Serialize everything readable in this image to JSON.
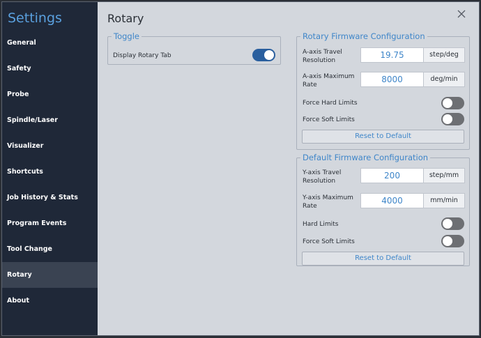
{
  "sidebar": {
    "title": "Settings",
    "items": [
      {
        "label": "General"
      },
      {
        "label": "Safety"
      },
      {
        "label": "Probe"
      },
      {
        "label": "Spindle/Laser"
      },
      {
        "label": "Visualizer"
      },
      {
        "label": "Shortcuts"
      },
      {
        "label": "Job History & Stats"
      },
      {
        "label": "Program Events"
      },
      {
        "label": "Tool Change"
      },
      {
        "label": "Rotary"
      },
      {
        "label": "About"
      }
    ],
    "active": "Rotary"
  },
  "main": {
    "title": "Rotary",
    "toggle_group": {
      "legend": "Toggle",
      "display_rotary_tab": {
        "label": "Display Rotary Tab",
        "on": true
      }
    },
    "rotary_firmware": {
      "legend": "Rotary Firmware Configuration",
      "travel_resolution": {
        "label_line1": "A-axis Travel",
        "label_line2": "Resolution",
        "value": "19.75",
        "unit": "step/deg"
      },
      "max_rate": {
        "label_line1": "A-axis Maximum",
        "label_line2": "Rate",
        "value": "8000",
        "unit": "deg/min"
      },
      "force_hard_limits": {
        "label": "Force Hard Limits",
        "on": false
      },
      "force_soft_limits": {
        "label": "Force Soft Limits",
        "on": false
      },
      "reset_label": "Reset to Default"
    },
    "default_firmware": {
      "legend": "Default Firmware Configuration",
      "travel_resolution": {
        "label_line1": "Y-axis Travel",
        "label_line2": "Resolution",
        "value": "200",
        "unit": "step/mm"
      },
      "max_rate": {
        "label_line1": "Y-axis Maximum",
        "label_line2": "Rate",
        "value": "4000",
        "unit": "mm/min"
      },
      "hard_limits": {
        "label": "Hard Limits",
        "on": false
      },
      "force_soft_limits": {
        "label": "Force Soft Limits",
        "on": false
      },
      "reset_label": "Reset to Default"
    }
  },
  "colors": {
    "sidebar_bg": "#1f2838",
    "sidebar_active": "#3a4352",
    "accent": "#3f86c9",
    "content_bg": "#d3d7dd",
    "switch_on": "#2a5f9e",
    "switch_off": "#6d6f73"
  },
  "icons": {
    "close": "close-icon"
  }
}
